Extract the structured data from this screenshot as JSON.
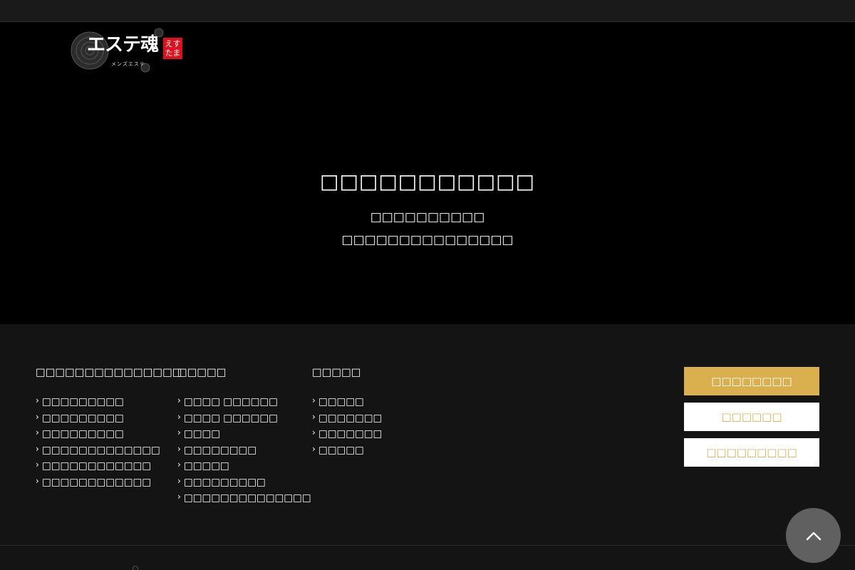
{
  "logo": {
    "main": "エステ魂",
    "badge": "えすたま",
    "sub": "メンズエステ"
  },
  "hero": {
    "title": "□□□□□□□□□□□",
    "line1": "□□□□□□□□□□",
    "line2": "□□□□□□□□□□□□□□□"
  },
  "footer": {
    "columns": [
      {
        "heading": "□□□□□□□□□□□□□□□",
        "items": [
          "□□□□□□□□□",
          "□□□□□□□□□",
          "□□□□□□□□□",
          "□□□□□□□□□□□□□",
          "□□□□□□□□□□□□",
          "□□□□□□□□□□□□"
        ]
      },
      {
        "heading": "□□□□□",
        "items": [
          "□□□□ □□□□□□",
          "□□□□ □□□□□□",
          "□□□□",
          "□□□□□□□□",
          "□□□□□",
          "□□□□□□□□□",
          "□□□□□□□□□□□□□□"
        ]
      },
      {
        "heading": "□□□□□",
        "items": [
          "□□□□□",
          "□□□□□□□",
          "□□□□□□□",
          "□□□□□"
        ]
      }
    ],
    "buttons": {
      "primary": "□□□□□□□□",
      "second": "□□□□□□",
      "third": "□□□□□□□□□"
    }
  },
  "colors": {
    "accent": "#d9b04d",
    "badge": "#e0101b",
    "hero_bg": "#000000",
    "footer_bg": "#141414",
    "to_top_bg": "#606060"
  },
  "icons": {
    "list_bullet": "chevron-right-icon",
    "to_top": "chevron-up-icon",
    "logo_flower": "rose-icon"
  }
}
